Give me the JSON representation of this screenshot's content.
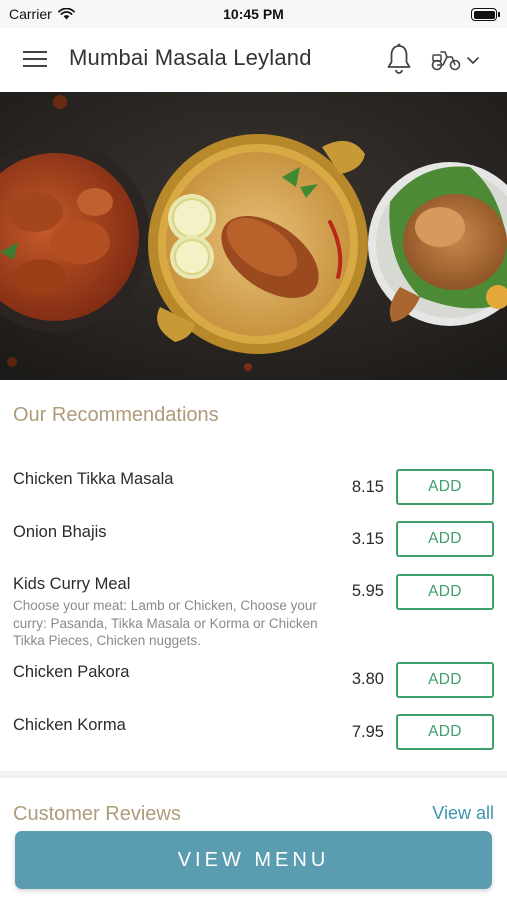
{
  "status_bar": {
    "carrier": "Carrier",
    "time": "10:45 PM"
  },
  "header": {
    "title": "Mumbai Masala Leyland",
    "icons": [
      "menu-icon",
      "bell-icon",
      "scooter-icon",
      "chevron-down-icon"
    ]
  },
  "hero": {
    "image": "food-banner"
  },
  "recommendations": {
    "title": "Our Recommendations",
    "items": [
      {
        "name": "Chicken Tikka Masala",
        "price": "8.15",
        "add_label": "ADD"
      },
      {
        "name": "Onion Bhajis",
        "price": "3.15",
        "add_label": "ADD"
      },
      {
        "name": "Kids Curry Meal",
        "description": "Choose your meat: Lamb or Chicken, Choose your curry: Pasanda, Tikka Masala or Korma or Chicken Tikka Pieces, Chicken nuggets.",
        "price": "5.95",
        "add_label": "ADD"
      },
      {
        "name": "Chicken Pakora",
        "price": "3.80",
        "add_label": "ADD"
      },
      {
        "name": "Chicken Korma",
        "price": "7.95",
        "add_label": "ADD"
      }
    ]
  },
  "reviews": {
    "title": "Customer Reviews",
    "view_all": "View all"
  },
  "cta": {
    "label": "VIEW MENU"
  },
  "colors": {
    "accent_gold": "#ad9b7b",
    "add_green": "#3f9f6b",
    "link_blue": "#3e95b1",
    "cta_blue": "#5a9cb0"
  }
}
